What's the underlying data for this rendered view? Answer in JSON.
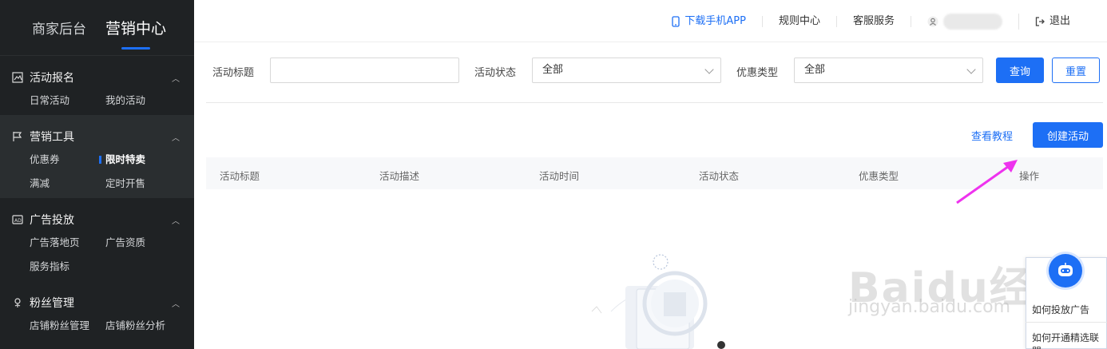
{
  "sidebar": {
    "tabs": [
      {
        "label": "商家后台"
      },
      {
        "label": "营销中心"
      }
    ],
    "groups": [
      {
        "title": "活动报名",
        "icon": "image-icon",
        "items": [
          "日常活动",
          "我的活动"
        ]
      },
      {
        "title": "营销工具",
        "icon": "flag-icon",
        "items": [
          "优惠券",
          "限时特卖",
          "满减",
          "定时开售"
        ],
        "active_item": "限时特卖"
      },
      {
        "title": "广告投放",
        "icon": "ad-icon",
        "items": [
          "广告落地页",
          "广告资质",
          "服务指标"
        ]
      },
      {
        "title": "粉丝管理",
        "icon": "flower-icon",
        "items": [
          "店铺粉丝管理",
          "店铺粉丝分析"
        ]
      }
    ]
  },
  "topnav": {
    "download_app": "下载手机APP",
    "rules": "规则中心",
    "service": "客服服务",
    "logout": "退出"
  },
  "filters": {
    "title_label": "活动标题",
    "title_value": "",
    "status_label": "活动状态",
    "status_value": "全部",
    "discount_label": "优惠类型",
    "discount_value": "全部",
    "query_button": "查询",
    "reset_button": "重置"
  },
  "actions": {
    "tutorial_link": "查看教程",
    "create_button": "创建活动"
  },
  "table": {
    "columns": [
      "活动标题",
      "活动描述",
      "活动时间",
      "活动状态",
      "优惠类型",
      "操作"
    ]
  },
  "help": {
    "items": [
      "如何投放广告",
      "如何开通精选联盟"
    ]
  },
  "watermark": {
    "main": "Baidu经验",
    "sub": "jingyan.baidu.com"
  },
  "colors": {
    "primary": "#1d6ff5",
    "sidebar_bg": "#1f2224",
    "annotation_arrow": "#ee33ee"
  }
}
